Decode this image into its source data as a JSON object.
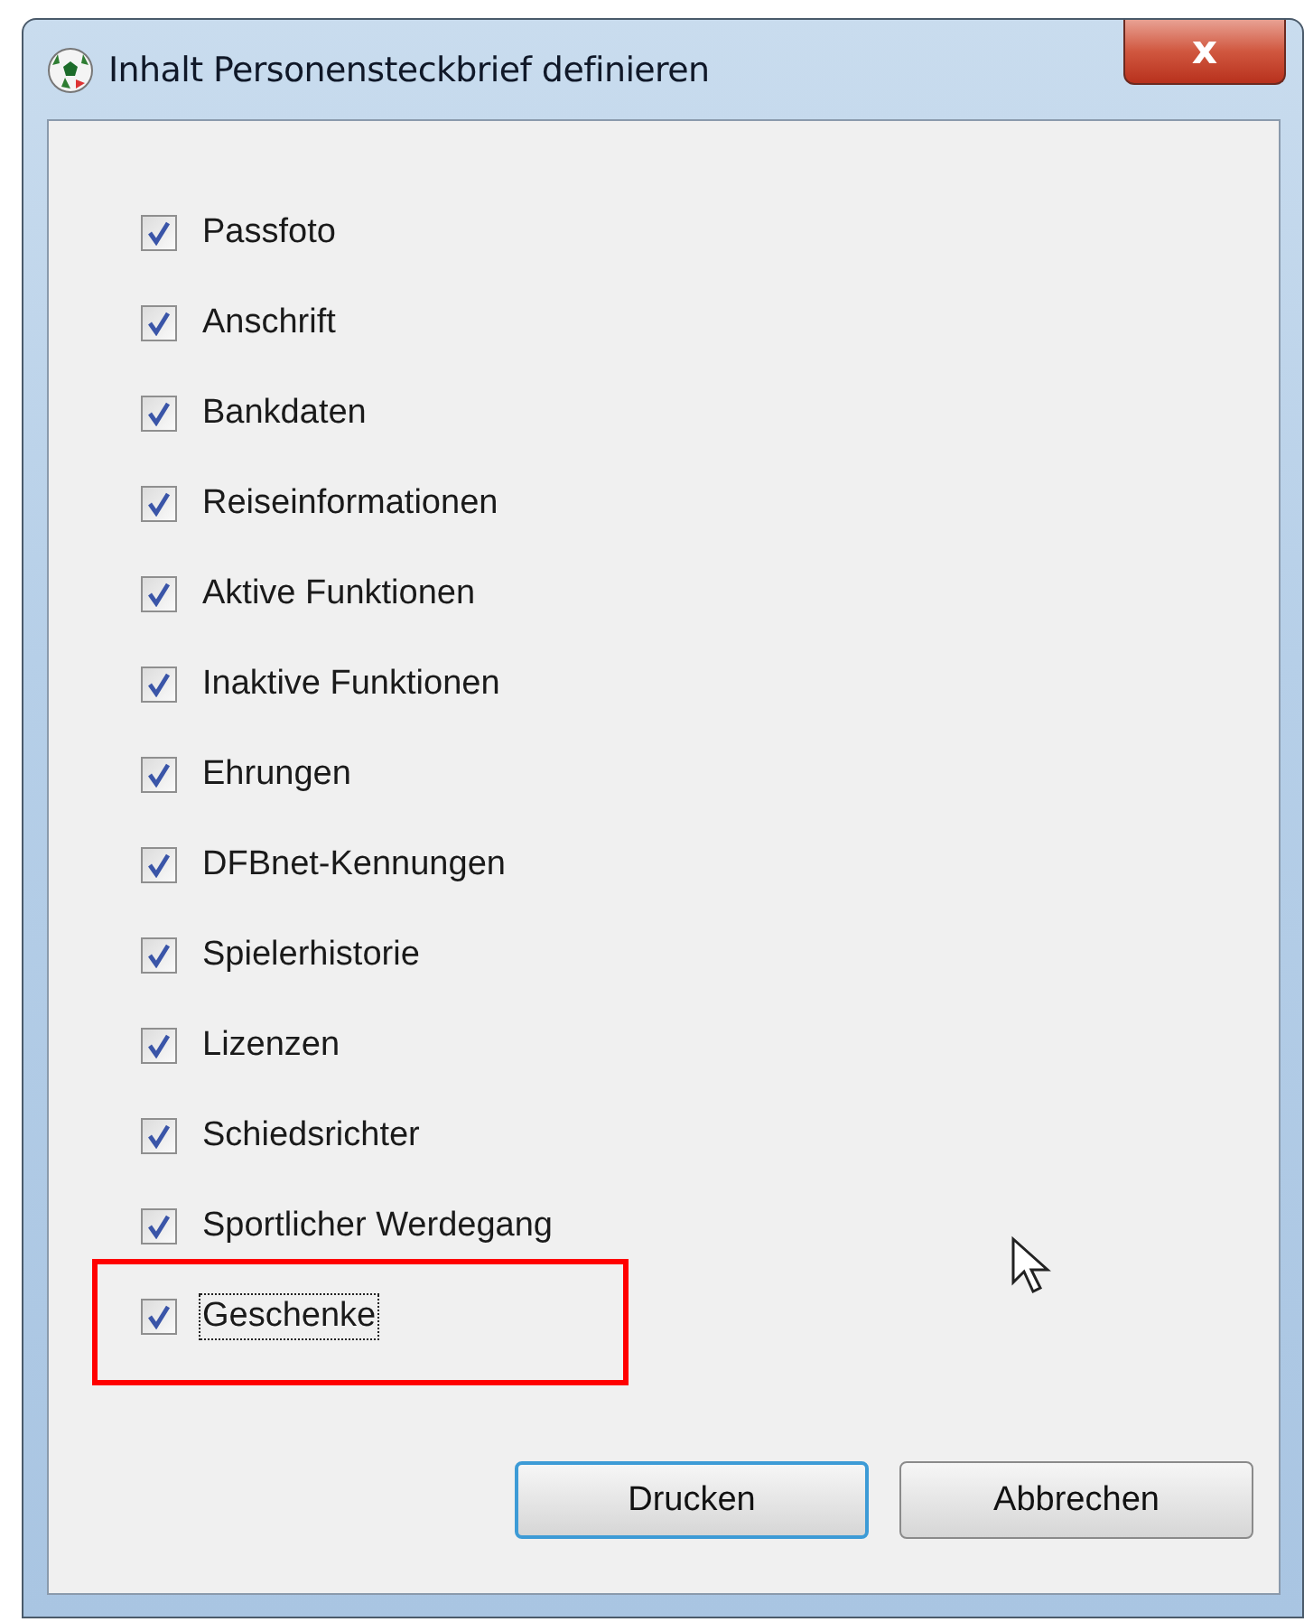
{
  "window": {
    "title": "Inhalt Personensteckbrief definieren",
    "close_label": "x"
  },
  "items": [
    {
      "label": "Passfoto",
      "checked": true,
      "focused": false,
      "highlighted": false
    },
    {
      "label": "Anschrift",
      "checked": true,
      "focused": false,
      "highlighted": false
    },
    {
      "label": "Bankdaten",
      "checked": true,
      "focused": false,
      "highlighted": false
    },
    {
      "label": "Reiseinformationen",
      "checked": true,
      "focused": false,
      "highlighted": false
    },
    {
      "label": "Aktive Funktionen",
      "checked": true,
      "focused": false,
      "highlighted": false
    },
    {
      "label": "Inaktive Funktionen",
      "checked": true,
      "focused": false,
      "highlighted": false
    },
    {
      "label": "Ehrungen",
      "checked": true,
      "focused": false,
      "highlighted": false
    },
    {
      "label": "DFBnet-Kennungen",
      "checked": true,
      "focused": false,
      "highlighted": false
    },
    {
      "label": "Spielerhistorie",
      "checked": true,
      "focused": false,
      "highlighted": false
    },
    {
      "label": "Lizenzen",
      "checked": true,
      "focused": false,
      "highlighted": false
    },
    {
      "label": "Schiedsrichter",
      "checked": true,
      "focused": false,
      "highlighted": false
    },
    {
      "label": "Sportlicher Werdegang",
      "checked": true,
      "focused": false,
      "highlighted": false
    },
    {
      "label": "Geschenke",
      "checked": true,
      "focused": true,
      "highlighted": true
    }
  ],
  "buttons": [
    {
      "label": "Drucken",
      "default": true
    },
    {
      "label": "Abbrechen",
      "default": false
    }
  ]
}
